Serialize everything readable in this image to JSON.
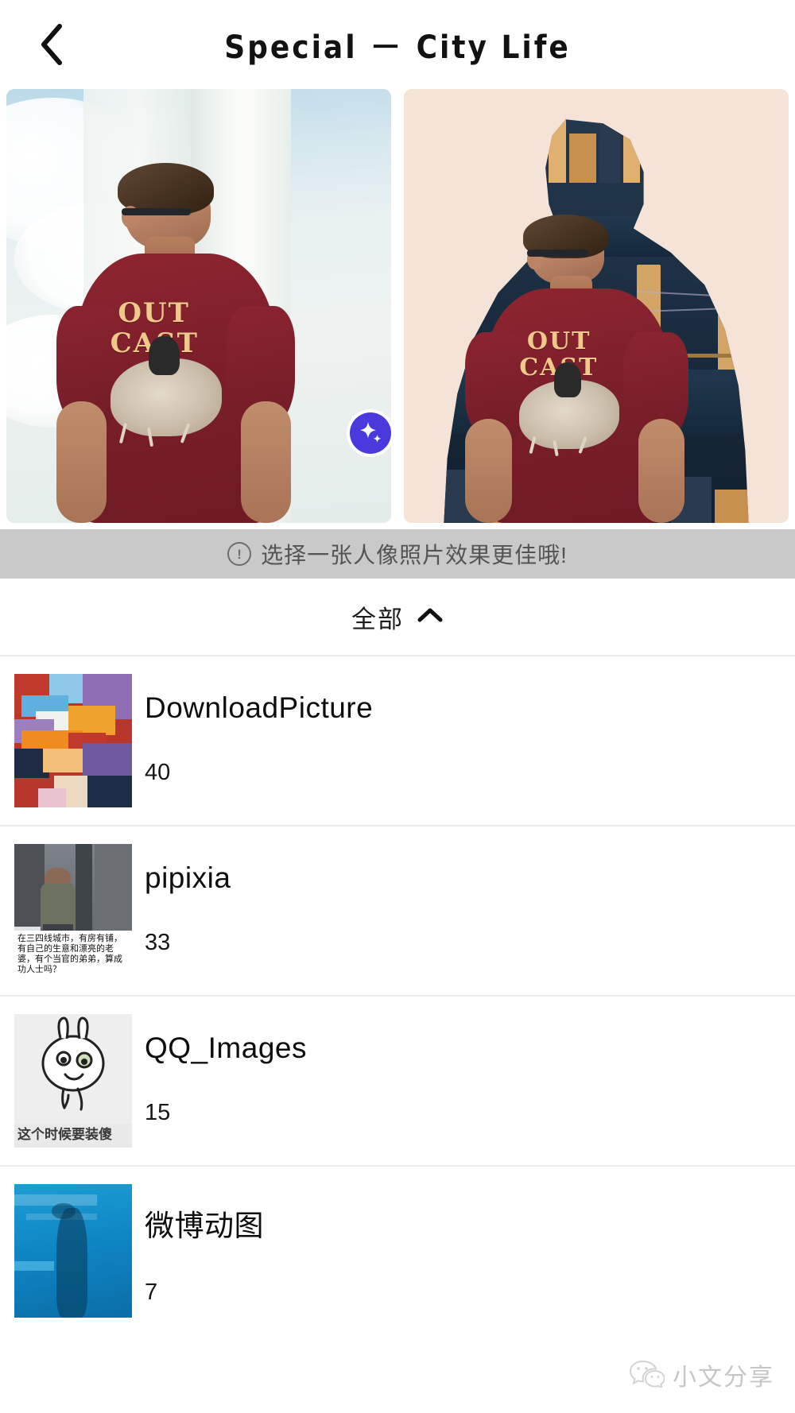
{
  "header": {
    "back_icon": "chevron-left-icon",
    "title": "Special － City Life"
  },
  "preview": {
    "before_label": "original-photo",
    "after_label": "city-life-effect-photo",
    "shirt_text_line1": "OUT",
    "shirt_text_line2": "CAST",
    "sparkle_button": {
      "icon": "sparkle-icon",
      "color": "#4a39dd"
    }
  },
  "notice": {
    "icon": "exclamation-circle-icon",
    "icon_glyph": "!",
    "text": "选择一张人像照片效果更佳哦!",
    "background": "#c9c9c9"
  },
  "filter": {
    "label": "全部",
    "chevron_icon": "chevron-up-icon",
    "expanded": true
  },
  "albums": [
    {
      "name": "DownloadPicture",
      "count": "40",
      "thumb": "colorful-mural-thumbnail",
      "caption": ""
    },
    {
      "name": "pipixia",
      "count": "33",
      "thumb": "movie-still-thumbnail",
      "caption": "在三四线城市，有房有铺，有自己的生意和漂亮的老婆，有个当官的弟弟，算成功人士吗？"
    },
    {
      "name": "QQ_Images",
      "count": "15",
      "thumb": "rabbit-doodle-thumbnail",
      "caption": "这个时候要装傻"
    },
    {
      "name": "微博动图",
      "count": "7",
      "thumb": "underwater-thumbnail",
      "caption": ""
    }
  ],
  "watermark": {
    "icon": "wechat-icon",
    "text": "小文分享"
  }
}
